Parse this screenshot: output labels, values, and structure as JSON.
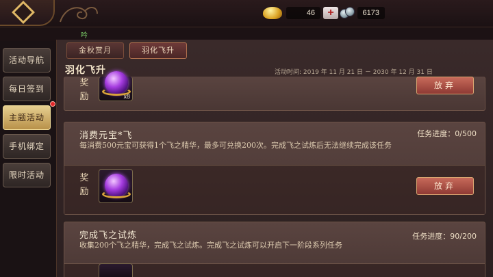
{
  "header": {
    "gold": "46",
    "coins": "6173",
    "subtext": "吟"
  },
  "sidebar": {
    "items": [
      {
        "label": "活动导航"
      },
      {
        "label": "每日签到"
      },
      {
        "label": "主题活动"
      },
      {
        "label": "手机绑定"
      },
      {
        "label": "限时活动"
      }
    ]
  },
  "tabs": [
    {
      "label": "金秋赏月"
    },
    {
      "label": "羽化飞升"
    }
  ],
  "event": {
    "title": "羽化飞升",
    "time": "活动时间: 2019 年 11 月 21 日 － 2030 年 12 月 31 日"
  },
  "tasks": [
    {
      "title": "",
      "desc": "",
      "progress": "",
      "reward_label": "奖励",
      "item_count": "x8",
      "button": "放弃"
    },
    {
      "title": "消费元宝*飞",
      "desc": "每消费500元宝可获得1个飞之精华，最多可兑换200次。完成飞之试炼后无法继续完成该任务",
      "progress": "任务进度：0/500",
      "reward_label": "奖励",
      "button": "放弃"
    },
    {
      "title": "完成飞之试炼",
      "desc": "收集200个飞之精华，完成飞之试炼。完成飞之试炼可以开启下一阶段系列任务",
      "progress": "任务进度：90/200"
    }
  ],
  "colors": {
    "accent_gold": "#e0b866",
    "button_red": "#c76a5a",
    "active_tab": "#e7cf8f"
  }
}
